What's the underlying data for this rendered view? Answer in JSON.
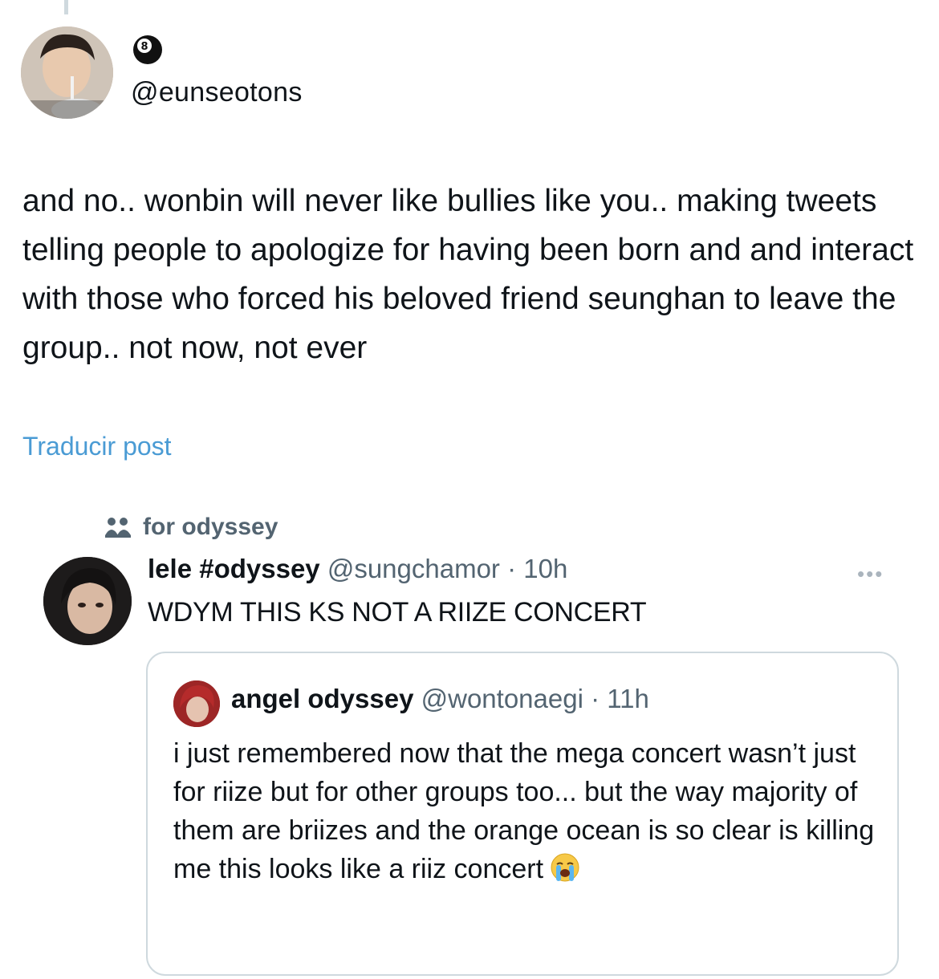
{
  "post": {
    "badge_digit": "8",
    "handle": "@eunseotons",
    "text": "and no.. wonbin will never like bullies like you.. making tweets telling people to apologize for having been born and and interact with those who forced his beloved friend seunghan to leave the group.. not now, not ever",
    "translate_label": "Traducir post"
  },
  "embedded": {
    "community_label": "for odyssey",
    "author_name": "lele #odyssey",
    "author_handle_time": "@sungchamor · 10h",
    "more_label": "•••",
    "text": "WDYM THIS KS NOT A RIIZE CONCERT",
    "quote": {
      "author_name": "angel odyssey",
      "author_handle_time": "@wontonaegi · 11h",
      "text": "i just remembered now that the mega concert wasn’t just for riize but for other groups too... but the way majority of them are briizes and the orange ocean is so clear is killing me this looks like a riiz concert",
      "emoji": "loudly-crying-face"
    }
  },
  "colors": {
    "text_primary": "#0f1419",
    "text_secondary": "#536471",
    "link": "#4a9bd4",
    "border": "#cfd9de"
  }
}
